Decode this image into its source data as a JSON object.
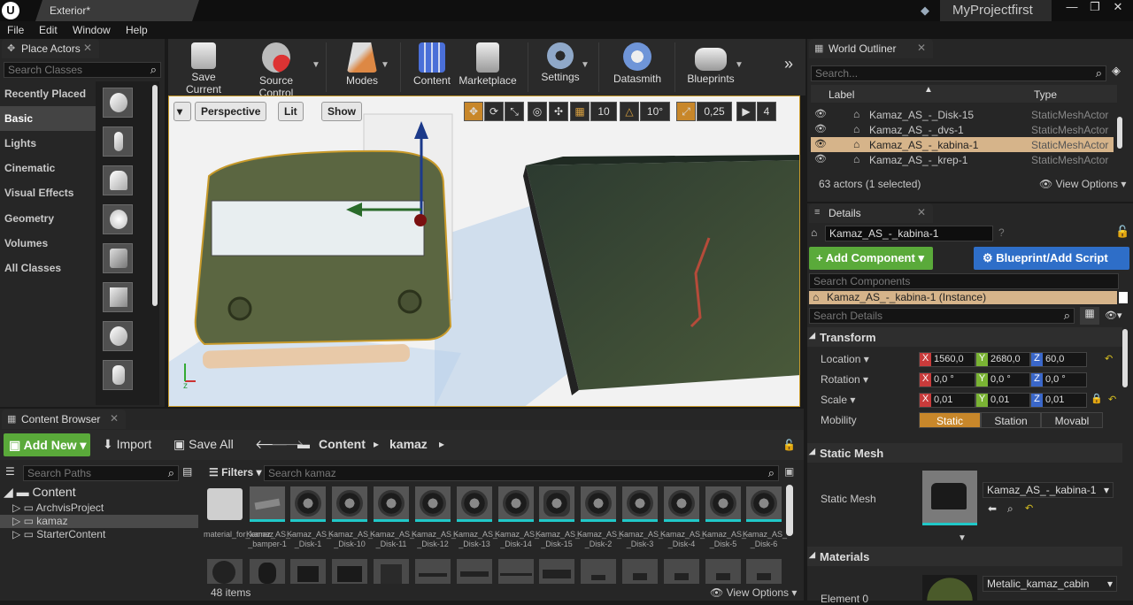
{
  "titlebar": {
    "logo": "U",
    "tab": "Exterior*",
    "project": "MyProjectfirst",
    "win_min": "—",
    "win_max": "❐",
    "win_close": "✕"
  },
  "menu": [
    "File",
    "Edit",
    "Window",
    "Help"
  ],
  "place_actors": {
    "tab": "Place Actors",
    "search_placeholder": "Search Classes",
    "categories": [
      "Recently Placed",
      "Basic",
      "Lights",
      "Cinematic",
      "Visual Effects",
      "Geometry",
      "Volumes",
      "All Classes"
    ]
  },
  "toolbar": {
    "items": [
      {
        "label": "Save Current"
      },
      {
        "label": "Source Control"
      },
      {
        "label": "Modes"
      },
      {
        "label": "Content"
      },
      {
        "label": "Marketplace"
      },
      {
        "label": "Settings"
      },
      {
        "label": "Datasmith"
      },
      {
        "label": "Blueprints"
      }
    ],
    "more": "»"
  },
  "viewport": {
    "perspective": "Perspective",
    "lit": "Lit",
    "show": "Show",
    "snap_grid": "10",
    "snap_angle": "10°",
    "snap_scale": "0,25",
    "cam_speed": "4"
  },
  "world_outliner": {
    "tab": "World Outliner",
    "search_placeholder": "Search...",
    "col_label": "Label",
    "col_type": "Type",
    "rows": [
      {
        "name": "Kamaz_AS_-_Disk-15",
        "type": "StaticMeshActor"
      },
      {
        "name": "Kamaz_AS_-_dvs-1",
        "type": "StaticMeshActor"
      },
      {
        "name": "Kamaz_AS_-_kabina-1",
        "type": "StaticMeshActor"
      },
      {
        "name": "Kamaz_AS_-_krep-1",
        "type": "StaticMeshActor"
      }
    ],
    "count": "63 actors (1 selected)",
    "view_options": "View Options"
  },
  "details": {
    "tab": "Details",
    "name_value": "Kamaz_AS_-_kabina-1",
    "add_component": "+ Add Component",
    "blueprint_script": "Blueprint/Add Script",
    "search_components": "Search Components",
    "instance": "Kamaz_AS_-_kabina-1 (Instance)",
    "search_details": "Search Details",
    "transform_title": "Transform",
    "location_label": "Location",
    "rotation_label": "Rotation",
    "scale_label": "Scale",
    "mobility_label": "Mobility",
    "location": [
      "1560,0",
      "2680,0",
      "60,0"
    ],
    "rotation": [
      "0,0 °",
      "0,0 °",
      "0,0 °"
    ],
    "scale": [
      "0,01",
      "0,01",
      "0,01"
    ],
    "mobility": [
      "Static",
      "Station",
      "Movabl"
    ],
    "static_mesh_title": "Static Mesh",
    "static_mesh_label": "Static Mesh",
    "static_mesh_value": "Kamaz_AS_-_kabina-1",
    "materials_title": "Materials",
    "element0_label": "Element 0",
    "material_value": "Metalic_kamaz_cabin"
  },
  "content_browser": {
    "tab": "Content Browser",
    "add_new": "Add New",
    "import": "Import",
    "save_all": "Save All",
    "path": [
      "Content",
      "kamaz"
    ],
    "search_paths": "Search Paths",
    "filters": "Filters",
    "search_placeholder": "Search kamaz",
    "tree": [
      {
        "label": "Content"
      },
      {
        "label": "ArchvisProject"
      },
      {
        "label": "kamaz"
      },
      {
        "label": "StarterContent"
      }
    ],
    "assets": [
      "material_for_kamaz",
      "Kamaz_AS_-_bamper-1",
      "Kamaz_AS_-_Disk-1",
      "Kamaz_AS_-_Disk-10",
      "Kamaz_AS_-_Disk-11",
      "Kamaz_AS_-_Disk-12",
      "Kamaz_AS_-_Disk-13",
      "Kamaz_AS_-_Disk-14",
      "Kamaz_AS_-_Disk-15",
      "Kamaz_AS_-_Disk-2",
      "Kamaz_AS_-_Disk-3",
      "Kamaz_AS_-_Disk-4",
      "Kamaz_AS_-_Disk-5",
      "Kamaz_AS_-_Disk-6"
    ],
    "items_count": "48 items",
    "view_options": "View Options"
  }
}
